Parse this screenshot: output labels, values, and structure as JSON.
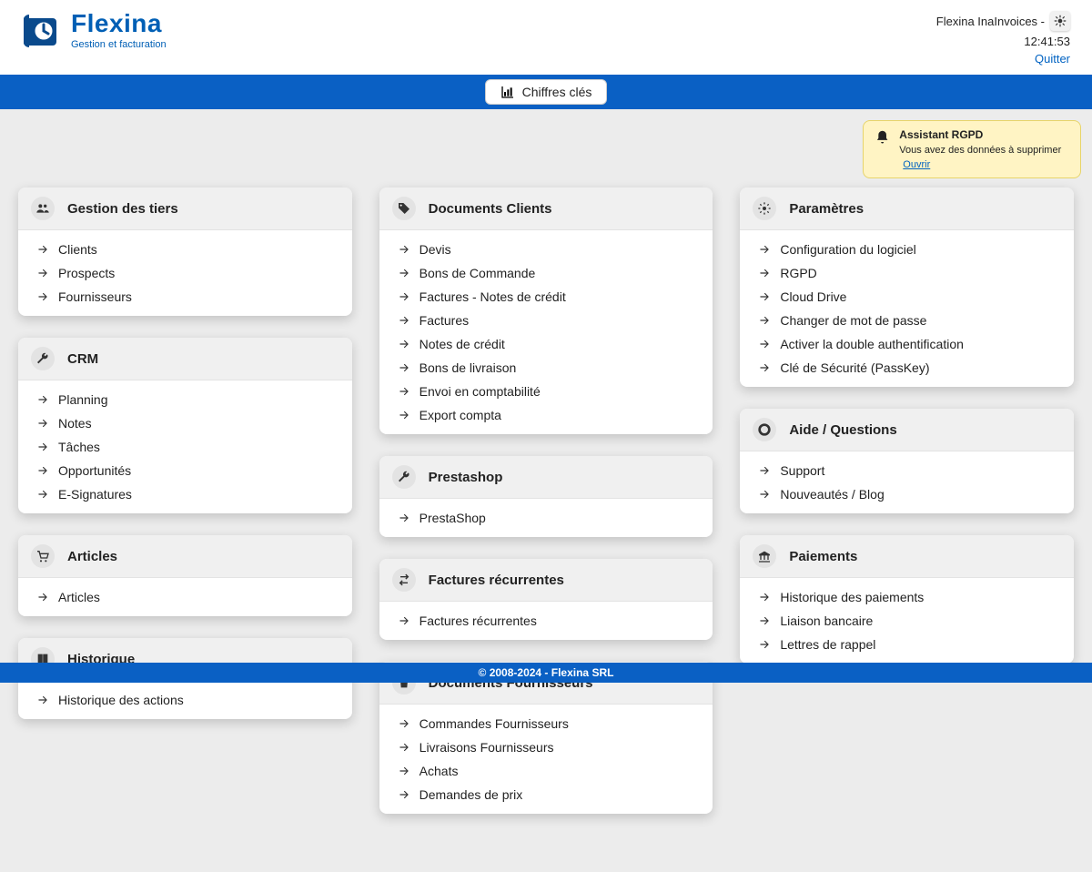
{
  "logo": {
    "name": "Flexina",
    "tagline": "Gestion et facturation"
  },
  "header": {
    "user": "Flexina InaInvoices -",
    "time": "12:41:53",
    "quit": "Quitter"
  },
  "keyfigures": {
    "label": "Chiffres clés"
  },
  "alert": {
    "title": "Assistant RGPD",
    "message": "Vous avez des données à supprimer",
    "action": "Ouvrir"
  },
  "columns": [
    [
      {
        "id": "tiers",
        "icon": "people",
        "title": "Gestion des tiers",
        "items": [
          "Clients",
          "Prospects",
          "Fournisseurs"
        ]
      },
      {
        "id": "crm",
        "icon": "wrench",
        "title": "CRM",
        "items": [
          "Planning",
          "Notes",
          "Tâches",
          "Opportunités",
          "E-Signatures"
        ]
      },
      {
        "id": "articles",
        "icon": "cart",
        "title": "Articles",
        "items": [
          "Articles"
        ]
      },
      {
        "id": "history",
        "icon": "book",
        "title": "Historique",
        "items": [
          "Historique des actions"
        ]
      }
    ],
    [
      {
        "id": "docclient",
        "icon": "tag",
        "title": "Documents Clients",
        "items": [
          "Devis",
          "Bons de Commande",
          "Factures - Notes de crédit",
          "Factures",
          "Notes de crédit",
          "Bons de livraison",
          "Envoi en comptabilité",
          "Export compta"
        ]
      },
      {
        "id": "presta",
        "icon": "wrench",
        "title": "Prestashop",
        "items": [
          "PrestaShop"
        ]
      },
      {
        "id": "recur",
        "icon": "repeat",
        "title": "Factures récurrentes",
        "items": [
          "Factures récurrentes"
        ]
      },
      {
        "id": "docsupp",
        "icon": "bag",
        "title": "Documents Fournisseurs",
        "items": [
          "Commandes Fournisseurs",
          "Livraisons Fournisseurs",
          "Achats",
          "Demandes de prix"
        ]
      }
    ],
    [
      {
        "id": "params",
        "icon": "gear",
        "title": "Paramètres",
        "items": [
          "Configuration du logiciel",
          "RGPD",
          "Cloud Drive",
          "Changer de mot de passe",
          "Activer la double authentification",
          "Clé de Sécurité (PassKey)"
        ]
      },
      {
        "id": "help",
        "icon": "donut",
        "title": "Aide / Questions",
        "items": [
          "Support",
          "Nouveautés / Blog"
        ]
      },
      {
        "id": "pay",
        "icon": "bank",
        "title": "Paiements",
        "items": [
          "Historique des paiements",
          "Liaison bancaire",
          "Lettres de rappel"
        ]
      }
    ]
  ],
  "footer": "© 2008-2024 - Flexina SRL"
}
